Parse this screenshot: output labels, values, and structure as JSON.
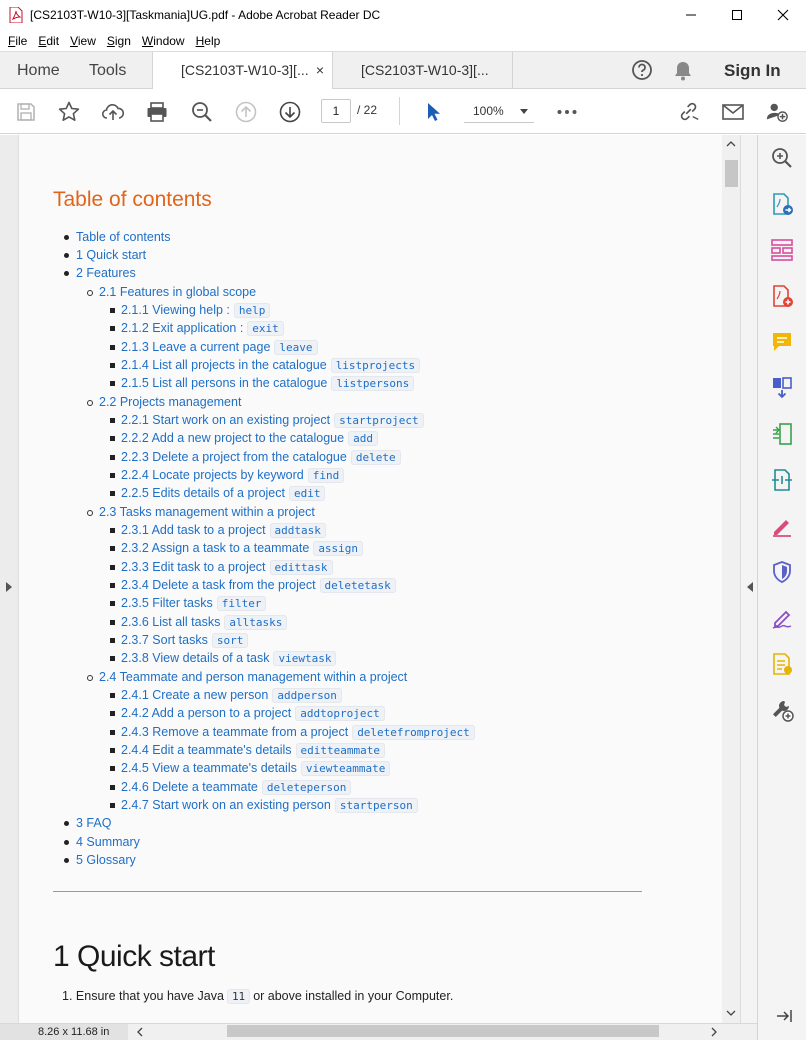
{
  "window": {
    "title": "[CS2103T-W10-3][Taskmania]UG.pdf - Adobe Acrobat Reader DC",
    "minimize_icon": "minimize-icon",
    "maximize_icon": "maximize-icon",
    "close_icon": "close-icon"
  },
  "menu": {
    "items": [
      {
        "key": "F",
        "rest": "ile"
      },
      {
        "key": "E",
        "rest": "dit"
      },
      {
        "key": "V",
        "rest": "iew"
      },
      {
        "key": "S",
        "rest": "ign"
      },
      {
        "key": "W",
        "rest": "indow"
      },
      {
        "key": "H",
        "rest": "elp"
      }
    ]
  },
  "tabs": {
    "home": "Home",
    "tools": "Tools",
    "documents": [
      {
        "label": "[CS2103T-W10-3][...",
        "active": true,
        "close": "×"
      },
      {
        "label": "[CS2103T-W10-3][...",
        "active": false
      }
    ],
    "signin": "Sign In"
  },
  "toolbar": {
    "page_current": "1",
    "page_total": "/ 22",
    "zoom": "100%",
    "icons": [
      "save-icon",
      "bookmark-star-icon",
      "upload-icon",
      "print-icon",
      "zoom-out-icon",
      "prev-page-icon",
      "next-page-icon",
      "select-cursor-icon",
      "more-icon",
      "share-link-icon",
      "email-icon",
      "add-user-icon"
    ]
  },
  "statusbar": {
    "page_size": "8.26 x 11.68 in"
  },
  "right_panel": {
    "icons": [
      "search-zoom-icon",
      "export-pdf-icon",
      "organize-pages-icon",
      "create-pdf-icon",
      "comment-icon",
      "combine-files-icon",
      "compress-icon",
      "edit-pdf-icon",
      "fill-sign-icon",
      "protect-icon",
      "sign-pen-icon",
      "sticky-note-icon",
      "more-tools-icon"
    ]
  },
  "document": {
    "toc_heading": "Table of contents",
    "toc": {
      "l1": [
        "Table of contents",
        "1 Quick start",
        "2 Features",
        "3 FAQ",
        "4 Summary",
        "5 Glossary"
      ],
      "s21": "2.1 Features in global scope",
      "s22": "2.2 Projects management",
      "s23": "2.3 Tasks management within a project",
      "s24": "2.4 Teammate and person management within a project",
      "items21": [
        {
          "text": "2.1.1 Viewing help :",
          "cmd": "help"
        },
        {
          "text": "2.1.2 Exit application :",
          "cmd": "exit"
        },
        {
          "text": "2.1.3 Leave a current page",
          "cmd": "leave"
        },
        {
          "text": "2.1.4 List all projects in the catalogue",
          "cmd": "listprojects"
        },
        {
          "text": "2.1.5 List all persons in the catalogue",
          "cmd": "listpersons"
        }
      ],
      "items22": [
        {
          "text": "2.2.1 Start work on an existing project",
          "cmd": "startproject"
        },
        {
          "text": "2.2.2 Add a new project to the catalogue",
          "cmd": "add"
        },
        {
          "text": "2.2.3 Delete a project from the catalogue",
          "cmd": "delete"
        },
        {
          "text": "2.2.4 Locate projects by keyword",
          "cmd": "find"
        },
        {
          "text": "2.2.5 Edits details of a project",
          "cmd": "edit"
        }
      ],
      "items23": [
        {
          "text": "2.3.1 Add task to a project",
          "cmd": "addtask"
        },
        {
          "text": "2.3.2 Assign a task to a teammate",
          "cmd": "assign"
        },
        {
          "text": "2.3.3 Edit task to a project",
          "cmd": "edittask"
        },
        {
          "text": "2.3.4 Delete a task from the project",
          "cmd": "deletetask"
        },
        {
          "text": "2.3.5 Filter tasks",
          "cmd": "filter"
        },
        {
          "text": "2.3.6 List all tasks",
          "cmd": "alltasks"
        },
        {
          "text": "2.3.7 Sort tasks",
          "cmd": "sort"
        },
        {
          "text": "2.3.8 View details of a task",
          "cmd": "viewtask"
        }
      ],
      "items24": [
        {
          "text": "2.4.1 Create a new person",
          "cmd": "addperson"
        },
        {
          "text": "2.4.2 Add a person to a project",
          "cmd": "addtoproject"
        },
        {
          "text": "2.4.3 Remove a teammate from a project",
          "cmd": "deletefromproject"
        },
        {
          "text": "2.4.4 Edit a teammate's details",
          "cmd": "editteammate"
        },
        {
          "text": "2.4.5 View a teammate's details",
          "cmd": "viewteammate"
        },
        {
          "text": "2.4.6 Delete a teammate",
          "cmd": "deleteperson"
        },
        {
          "text": "2.4.7 Start work on an existing person",
          "cmd": "startperson"
        }
      ]
    },
    "quick_start_heading": "1 Quick start",
    "quick_start_item": {
      "number": "1.",
      "before": "Ensure that you have Java",
      "code": "11",
      "after": "or above installed in your Computer."
    }
  }
}
